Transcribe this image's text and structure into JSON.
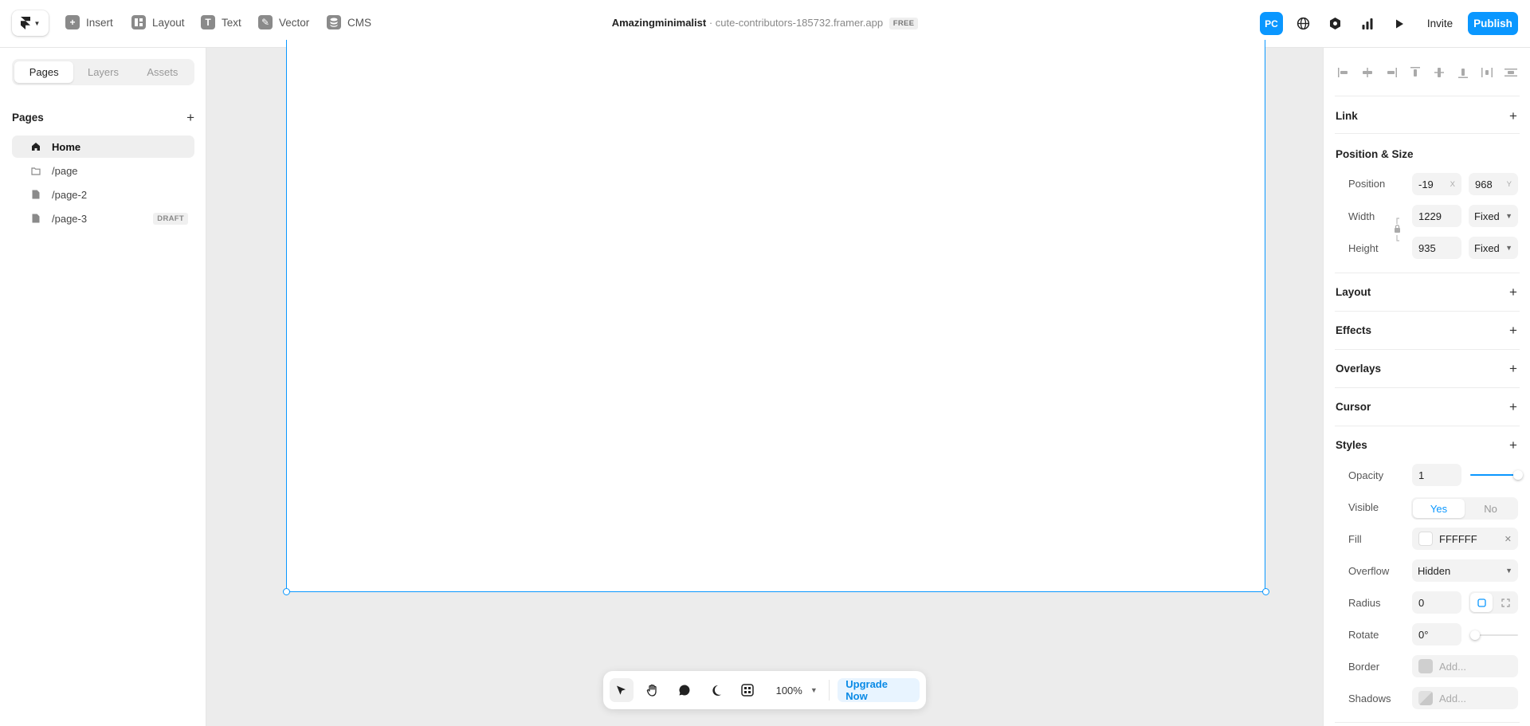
{
  "toolbar": {
    "items": [
      {
        "label": "Insert",
        "glyph": "+"
      },
      {
        "label": "Layout",
        "glyph": ""
      },
      {
        "label": "Text",
        "glyph": "T"
      },
      {
        "label": "Vector",
        "glyph": "✎"
      },
      {
        "label": "CMS",
        "glyph": ""
      }
    ]
  },
  "project": {
    "name": "Amazingminimalist",
    "separator": "·",
    "url": "cute-contributors-185732.framer.app",
    "plan_badge": "FREE"
  },
  "top_right": {
    "breakpoint": "PC",
    "invite_label": "Invite",
    "publish_label": "Publish"
  },
  "left_panel": {
    "tabs": [
      "Pages",
      "Layers",
      "Assets"
    ],
    "active_tab": "Pages",
    "section_title": "Pages",
    "pages": [
      {
        "label": "Home",
        "icon": "home-icon",
        "active": true
      },
      {
        "label": "/page",
        "icon": "folder-icon"
      },
      {
        "label": "/page-2",
        "icon": "file-icon"
      },
      {
        "label": "/page-3",
        "icon": "file-icon",
        "badge": "DRAFT"
      }
    ]
  },
  "bottom_bar": {
    "zoom": "100%",
    "upgrade_label": "Upgrade Now"
  },
  "right_panel": {
    "link_title": "Link",
    "pos_size_title": "Position & Size",
    "position_label": "Position",
    "x_value": "-19",
    "x_axis": "X",
    "y_value": "968",
    "y_axis": "Y",
    "width_label": "Width",
    "width_value": "1229",
    "width_mode": "Fixed",
    "height_label": "Height",
    "height_value": "935",
    "height_mode": "Fixed",
    "layout_title": "Layout",
    "effects_title": "Effects",
    "overlays_title": "Overlays",
    "cursor_title": "Cursor",
    "styles_title": "Styles",
    "opacity_label": "Opacity",
    "opacity_value": "1",
    "opacity_level": 1.0,
    "visible_label": "Visible",
    "visible_yes": "Yes",
    "visible_no": "No",
    "fill_label": "Fill",
    "fill_value": "FFFFFF",
    "fill_color": "#FFFFFF",
    "overflow_label": "Overflow",
    "overflow_value": "Hidden",
    "radius_label": "Radius",
    "radius_value": "0",
    "rotate_label": "Rotate",
    "rotate_value": "0°",
    "border_label": "Border",
    "border_placeholder": "Add...",
    "shadows_label": "Shadows",
    "shadows_placeholder": "Add..."
  },
  "colors": {
    "accent": "#0A97FF",
    "canvas": "#ECECEC"
  }
}
